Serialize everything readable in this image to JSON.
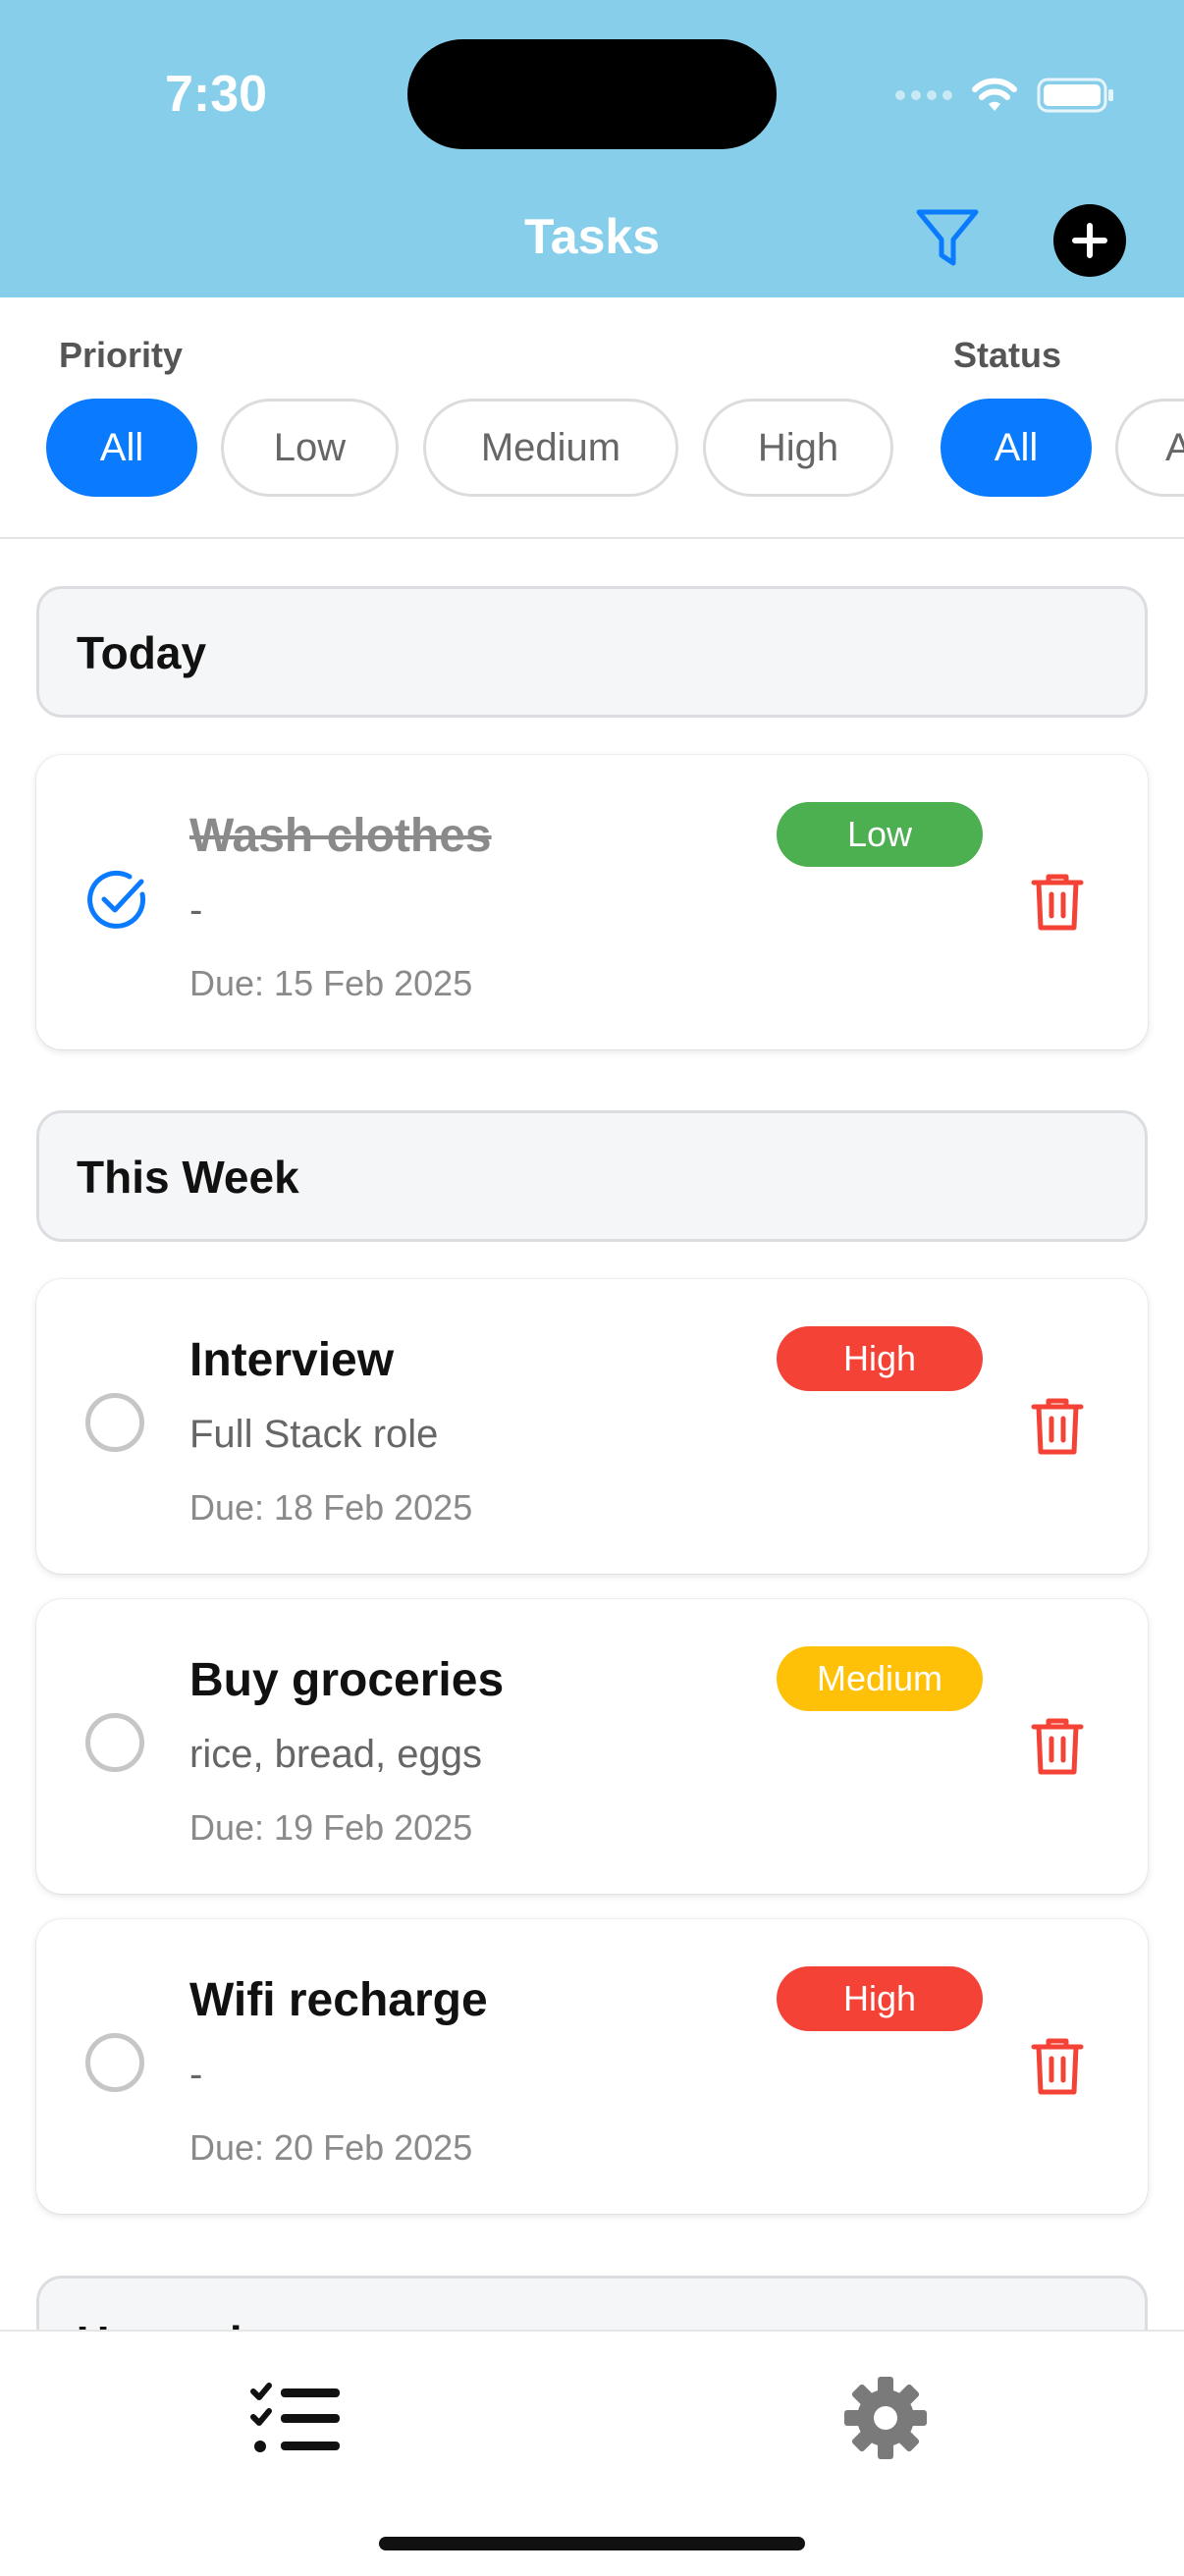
{
  "status_bar": {
    "time": "7:30"
  },
  "header": {
    "title": "Tasks"
  },
  "filters": {
    "priority_label": "Priority",
    "priority_options": [
      "All",
      "Low",
      "Medium",
      "High"
    ],
    "status_label": "Status",
    "status_options": [
      "All",
      "A"
    ]
  },
  "sections": [
    {
      "title": "Today"
    },
    {
      "title": "This Week"
    },
    {
      "title": "Upcoming"
    }
  ],
  "tasks": [
    {
      "title": "Wash clothes",
      "description": "-",
      "due": "Due: 15 Feb 2025",
      "priority": "Low",
      "completed": true,
      "badge_color": "#4CAF50"
    },
    {
      "title": "Interview",
      "description": "Full Stack role",
      "due": "Due: 18 Feb 2025",
      "priority": "High",
      "completed": false,
      "badge_color": "#F44336"
    },
    {
      "title": "Buy groceries",
      "description": "rice, bread, eggs",
      "due": "Due: 19 Feb 2025",
      "priority": "Medium",
      "completed": false,
      "badge_color": "#FFC107"
    },
    {
      "title": "Wifi recharge",
      "description": "-",
      "due": "Due: 20 Feb 2025",
      "priority": "High",
      "completed": false,
      "badge_color": "#F44336"
    }
  ],
  "icons": {
    "filter": "filter-icon",
    "add": "plus-icon",
    "delete": "trash-icon",
    "tasks_tab": "task-list-icon",
    "settings_tab": "gear-icon"
  },
  "colors": {
    "header": "#87CEEB",
    "accent": "#0A7BFF",
    "delete": "#F44336"
  }
}
